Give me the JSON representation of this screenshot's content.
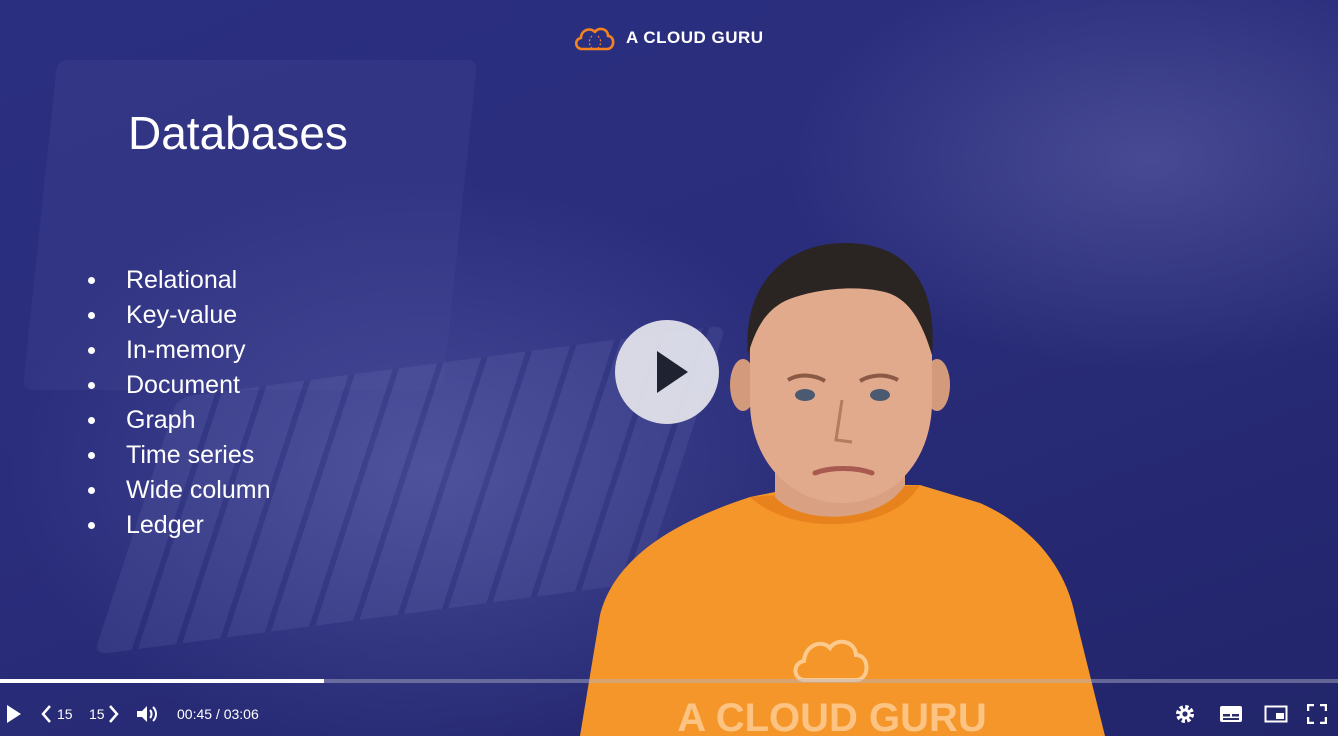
{
  "brand": {
    "name": "A CLOUD GURU",
    "accent": "#f58220"
  },
  "slide": {
    "title": "Databases",
    "bullets": [
      "Relational",
      "Key-value",
      "In-memory",
      "Document",
      "Graph",
      "Time series",
      "Wide column",
      "Ledger"
    ]
  },
  "presenter": {
    "shirt_color": "#f5962a",
    "shirt_text": "A CLOUD GURU"
  },
  "player": {
    "state": "paused",
    "progress_percent": 24.2,
    "current_time": "00:45",
    "duration": "03:06",
    "time_separator": " / ",
    "skip_back_label": "15",
    "skip_forward_label": "15",
    "icons": [
      "play-icon",
      "skip-back-icon",
      "skip-forward-icon",
      "volume-icon",
      "settings-icon",
      "captions-icon",
      "picture-in-picture-icon",
      "fullscreen-icon",
      "big-play-icon"
    ]
  }
}
